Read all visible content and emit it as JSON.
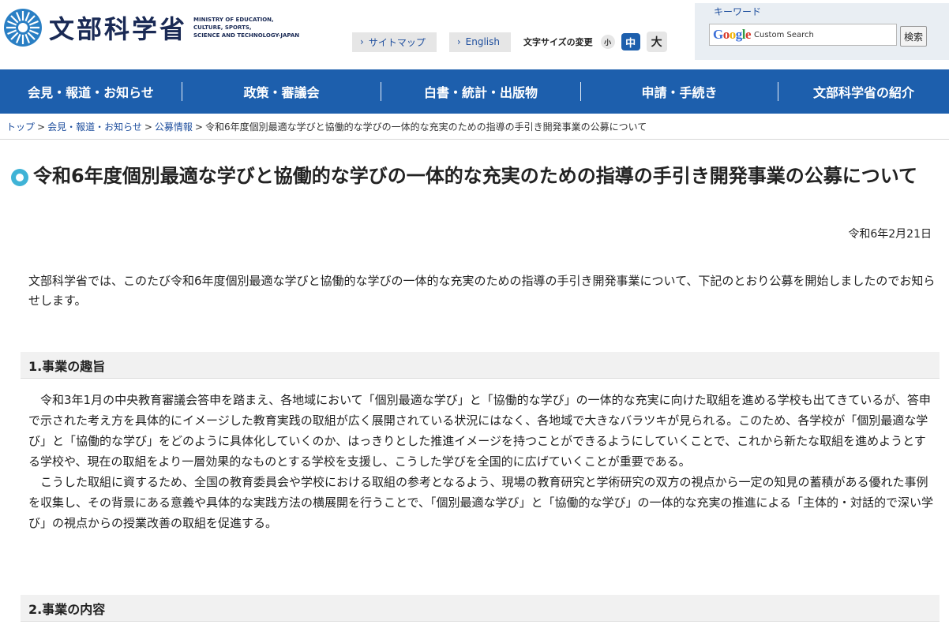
{
  "header": {
    "logo_jp": "文部科学省",
    "logo_en": [
      "MINISTRY OF EDUCATION,",
      "CULTURE, SPORTS,",
      "SCIENCE AND TECHNOLOGY-JAPAN"
    ],
    "links": [
      "サイトマップ",
      "English"
    ],
    "fontsize_label": "文字サイズの変更",
    "fontsize_small": "小",
    "fontsize_mid": "中",
    "fontsize_large": "大",
    "search_label": "キーワード",
    "search_placeholder": "Custom Search",
    "search_button": "検索",
    "google_text": "Google"
  },
  "nav": {
    "items": [
      "会見・報道・お知らせ",
      "政策・審議会",
      "白書・統計・出版物",
      "申請・手続き",
      "文部科学省の紹介"
    ]
  },
  "breadcrumb": {
    "items": [
      "トップ",
      "会見・報道・お知らせ",
      "公募情報"
    ],
    "current": "令和6年度個別最適な学びと協働的な学びの一体的な充実のための指導の手引き開発事業の公募について"
  },
  "page": {
    "title": "令和6年度個別最適な学びと協働的な学びの一体的な充実のための指導の手引き開発事業の公募について",
    "date": "令和6年2月21日",
    "intro": "文部科学省では、このたび令和6年度個別最適な学びと協働的な学びの一体的な充実のための指導の手引き開発事業について、下記のとおり公募を開始しましたのでお知らせします。",
    "section1_title": "1.事業の趣旨",
    "section1_p1": "令和3年1月の中央教育審議会答申を踏まえ、各地域において「個別最適な学び」と「協働的な学び」の一体的な充実に向けた取組を進める学校も出てきているが、答申で示された考え方を具体的にイメージした教育実践の取組が広く展開されている状況にはなく、各地域で大きなバラツキが見られる。このため、各学校が「個別最適な学び」と「協働的な学び」をどのように具体化していくのか、はっきりとした推進イメージを持つことができるようにしていくことで、これから新たな取組を進めようとする学校や、現在の取組をより一層効果的なものとする学校を支援し、こうした学びを全国的に広げていくことが重要である。",
    "section1_p2": "こうした取組に資するため、全国の教育委員会や学校における取組の参考となるよう、現場の教育研究と学術研究の双方の視点から一定の知見の蓄積がある優れた事例を収集し、その背景にある意義や具体的な実践方法の横展開を行うことで、「個別最適な学び」と「協働的な学び」の一体的な充実の推進による「主体的・対話的で深い学び」の視点からの授業改善の取組を促進する。",
    "section2_title": "2.事業の内容"
  }
}
